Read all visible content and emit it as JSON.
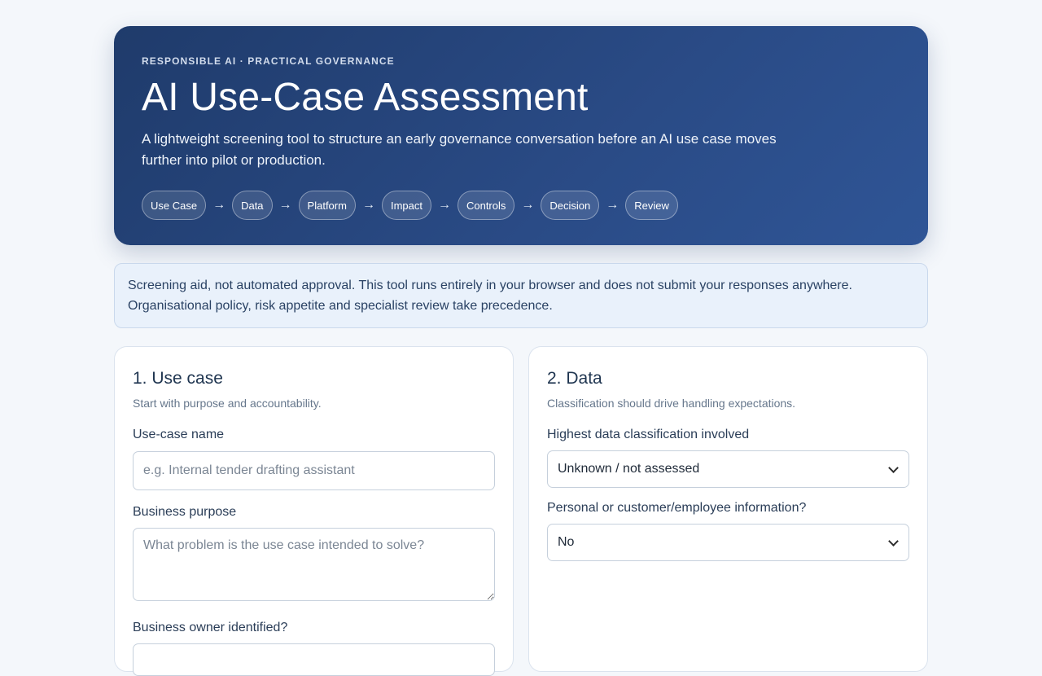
{
  "hero": {
    "eyebrow": "RESPONSIBLE AI · PRACTICAL GOVERNANCE",
    "title": "AI Use-Case Assessment",
    "subtitle": "A lightweight screening tool to structure an early governance conversation before an AI use case moves further into pilot or production.",
    "steps": [
      "Use Case",
      "Data",
      "Platform",
      "Impact",
      "Controls",
      "Decision",
      "Review"
    ],
    "arrow": "→"
  },
  "notice": {
    "text": "Screening aid, not automated approval. This tool runs entirely in your browser and does not submit your responses anywhere. Organisational policy, risk appetite and specialist review take precedence."
  },
  "use_case": {
    "title": "1. Use case",
    "subtitle": "Start with purpose and accountability.",
    "name_label": "Use-case name",
    "name_placeholder": "e.g. Internal tender drafting assistant",
    "purpose_label": "Business purpose",
    "purpose_placeholder": "What problem is the use case intended to solve?",
    "owner_label": "Business owner identified?"
  },
  "data_section": {
    "title": "2. Data",
    "subtitle": "Classification should drive handling expectations.",
    "classification_label": "Highest data classification involved",
    "classification_value": "Unknown / not assessed",
    "personal_label": "Personal or customer/employee information?",
    "personal_value": "No"
  },
  "colors": {
    "hero_gradient_start": "#1f3b6b",
    "hero_gradient_end": "#2f5596",
    "notice_bg": "#e9f1fb",
    "page_bg": "#f4f7fb"
  }
}
